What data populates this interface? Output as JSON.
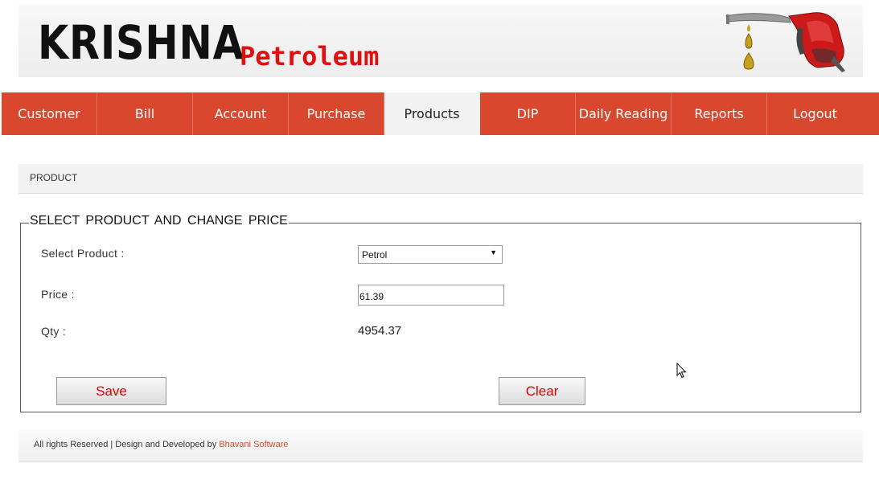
{
  "header": {
    "brand_main": "KRISHNA",
    "brand_sub": "Petroleum",
    "brand_color": "#e01010"
  },
  "nav": {
    "accent": "#d9472f",
    "items": [
      {
        "label": "Customer"
      },
      {
        "label": "Bill"
      },
      {
        "label": "Account"
      },
      {
        "label": "Purchase"
      },
      {
        "label": "Products",
        "active": true
      },
      {
        "label": "DIP"
      },
      {
        "label": "Daily Reading"
      },
      {
        "label": "Reports"
      },
      {
        "label": "Logout"
      }
    ]
  },
  "breadcrumb": {
    "text": "PRODUCT"
  },
  "form": {
    "legend": "SELECT  PRODUCT  AND CHANGE PRICE",
    "product_label": "Select Product :",
    "product_value": "Petrol",
    "price_label": "Price :",
    "price_value": "61.39",
    "qty_label": "Qty :",
    "qty_value": "4954.37",
    "save_label": "Save",
    "clear_label": "Clear"
  },
  "footer": {
    "text": "All rights Reserved | Design and Developed by ",
    "link": "Bhavani Software"
  }
}
